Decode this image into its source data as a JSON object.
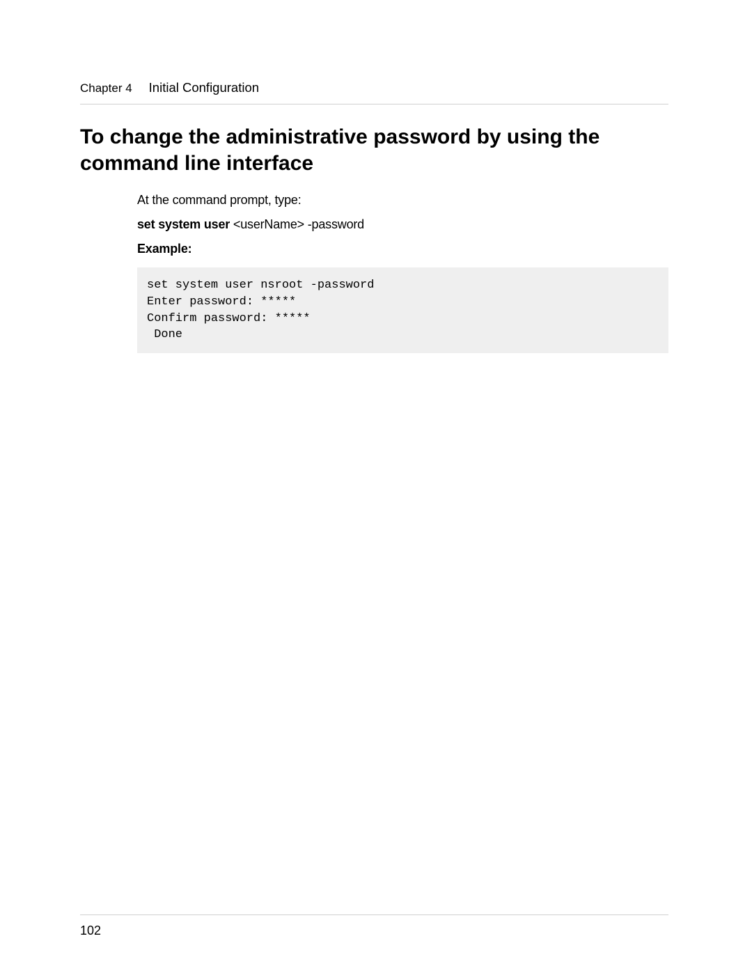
{
  "header": {
    "chapter_label": "Chapter 4",
    "chapter_title": "Initial Configuration"
  },
  "heading": "To change the administrative password by using the command line interface",
  "body": {
    "intro": "At the command prompt, type:",
    "command_bold": "set system user",
    "command_rest": " <userName> -password",
    "example_label": "Example:",
    "code": "set system user nsroot -password\nEnter password: *****\nConfirm password: *****\n Done"
  },
  "footer": {
    "page_number": "102"
  }
}
